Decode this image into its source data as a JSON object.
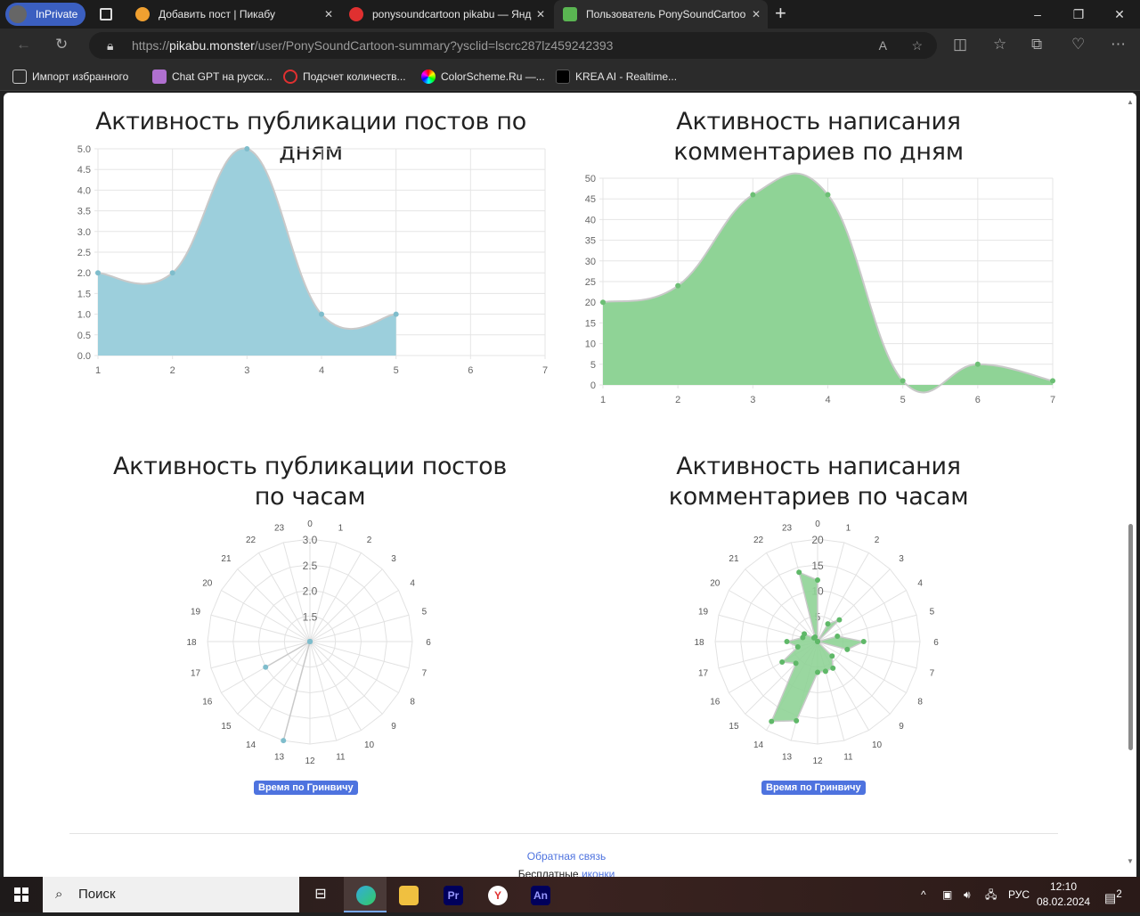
{
  "browser": {
    "inprivate": "InPrivate",
    "tabs": [
      {
        "title": "Добавить пост | Пикабу",
        "color": "#f0a030"
      },
      {
        "title": "ponysoundcartoon pikabu — Янд",
        "color": "#e03030"
      },
      {
        "title": "Пользователь PonySoundCartoo",
        "color": "#5ab552"
      }
    ],
    "url_prefix": "https://",
    "url_host": "pikabu.monster",
    "url_path": "/user/PonySoundCartoon-summary?ysclid=lscrc287lz459242393",
    "bookmarks": [
      {
        "label": "Импорт избранного",
        "color": "#555"
      },
      {
        "label": "Chat GPT на русск...",
        "color": "#b070d0"
      },
      {
        "label": "Подсчет количеств...",
        "color": "#e03030"
      },
      {
        "label": "ColorScheme.Ru —...",
        "color": "#e0a020"
      },
      {
        "label": "KREA AI - Realtime...",
        "color": "#000"
      }
    ]
  },
  "charts": {
    "posts_daily_title": "Активность публикации постов по дням",
    "comments_daily_title": "Активность написания комментариев по дням",
    "posts_hourly_title": "Активность публикации постов по часам",
    "comments_hourly_title": "Активность написания комментариев по часам",
    "gmt_label": "Время по Гринвичу"
  },
  "chart_data": [
    {
      "type": "area",
      "title": "Активность публикации постов по дням",
      "x": [
        1,
        2,
        3,
        4,
        5
      ],
      "values": [
        2,
        2,
        5,
        1,
        1
      ],
      "xlim": [
        1,
        7
      ],
      "ylim": [
        0,
        5
      ],
      "yticks": [
        0,
        0.5,
        1,
        1.5,
        2,
        2.5,
        3,
        3.5,
        4,
        4.5,
        5
      ],
      "color": "#9ccfdc",
      "grid": true
    },
    {
      "type": "area",
      "title": "Активность написания комментариев по дням",
      "x": [
        1,
        2,
        3,
        4,
        5,
        6,
        7
      ],
      "values": [
        20,
        24,
        46,
        46,
        1,
        5,
        1
      ],
      "xlim": [
        1,
        7
      ],
      "ylim": [
        0,
        50
      ],
      "yticks": [
        0,
        5,
        10,
        15,
        20,
        25,
        30,
        35,
        40,
        45,
        50
      ],
      "color": "#8fd396",
      "grid": true
    },
    {
      "type": "radar",
      "title": "Активность публикации постов по часам",
      "categories": [
        "0",
        "1",
        "2",
        "3",
        "4",
        "5",
        "6",
        "7",
        "8",
        "9",
        "10",
        "11",
        "12",
        "13",
        "14",
        "15",
        "16",
        "17",
        "18",
        "19",
        "20",
        "21",
        "22",
        "23"
      ],
      "values": [
        1,
        1,
        1,
        1,
        1,
        1,
        1,
        1,
        1,
        1,
        1,
        1,
        1,
        3,
        1,
        1,
        2,
        1,
        1,
        1,
        1,
        1,
        1,
        1
      ],
      "rlim": [
        1,
        3
      ],
      "rticks": [
        1.5,
        2,
        2.5,
        3
      ],
      "color": "#9ccfdc"
    },
    {
      "type": "radar",
      "title": "Активность написания комментариев по часам",
      "categories": [
        "0",
        "1",
        "2",
        "3",
        "4",
        "5",
        "6",
        "7",
        "8",
        "9",
        "10",
        "11",
        "12",
        "13",
        "14",
        "15",
        "16",
        "17",
        "18",
        "19",
        "20",
        "21",
        "22",
        "23"
      ],
      "values": [
        12,
        0,
        4,
        6,
        0,
        4,
        9,
        6,
        0,
        4,
        6,
        6,
        6,
        16,
        18,
        6,
        8,
        4,
        6,
        3,
        3,
        1,
        1,
        14
      ],
      "rlim": [
        0,
        20
      ],
      "rticks": [
        5,
        10,
        15,
        20
      ],
      "color": "#8fd396"
    }
  ],
  "footer": {
    "feedback": "Обратная связь",
    "free": "Бесплатные ",
    "icons": "иконки"
  },
  "taskbar": {
    "search": "Поиск",
    "lang": "РУС",
    "time": "12:10",
    "date": "08.02.2024",
    "notif": "2"
  }
}
